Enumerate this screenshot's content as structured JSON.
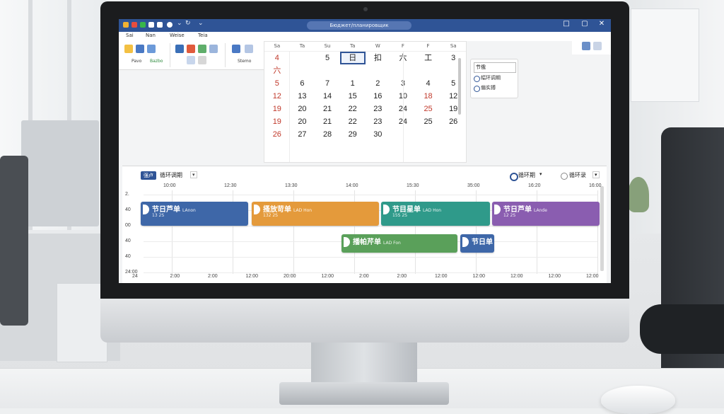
{
  "window": {
    "title": "Бюджет/планировщик",
    "controls": [
      "□",
      "▢",
      "✕"
    ]
  },
  "menu": [
    "Sai",
    "Nan",
    "Weise",
    "Teia"
  ],
  "ribbon": {
    "groups": [
      {
        "label": "Pavo"
      },
      {
        "label": "Bazbo"
      },
      {
        "label": "Stemo"
      }
    ]
  },
  "calendar": {
    "headers": [
      "Sa",
      "Ta",
      "Su",
      "Ta",
      "W",
      "F",
      "F",
      "Sa"
    ],
    "rows": [
      [
        "4",
        "",
        "5",
        "日",
        "扣",
        "六",
        "工",
        "3"
      ],
      [
        "六",
        "",
        "",
        "",
        "",
        "",
        "",
        ""
      ],
      [
        "5",
        "6",
        "7",
        "1",
        "2",
        "3",
        "4",
        "5"
      ],
      [
        "12",
        "13",
        "14",
        "15",
        "16",
        "10",
        "18",
        "12"
      ],
      [
        "19",
        "20",
        "21",
        "22",
        "23",
        "24",
        "25",
        "19"
      ],
      [
        "19",
        "20",
        "21",
        "22",
        "23",
        "24",
        "25",
        "26"
      ],
      [
        "26",
        "27",
        "28",
        "29",
        "30",
        "",
        "",
        ""
      ]
    ]
  },
  "options": {
    "input_value": "节俄",
    "radio1": "幅环调期",
    "radio2": "偏实搏"
  },
  "schedule": {
    "tag": "强卢",
    "label": "循环调期",
    "right_radio1": "循环期",
    "right_radio2": "循环录",
    "top_ticks": [
      "10:00",
      "12:30",
      "13:30",
      "14:00",
      "15:30",
      "35:00",
      "16:20",
      "16:00"
    ],
    "left_ticks": [
      "2.",
      "40",
      "00",
      "40",
      "40",
      "24:00"
    ],
    "bottom_ticks": [
      "24",
      "2:00",
      "2:00",
      "12:00",
      "20:00",
      "12:00",
      "2:00",
      "2:00",
      "12:00",
      "12:00",
      "12:00",
      "12:00",
      "12:00"
    ],
    "events": [
      {
        "title": "节日芦单",
        "note": "LAnon",
        "time": "13 2S",
        "color": "#3e67a8"
      },
      {
        "title": "搔放苛单",
        "note": "LAD Hon",
        "time": "132 2S",
        "color": "#e49a3b"
      },
      {
        "title": "节目星单",
        "note": "LAD Hon",
        "time": "15S 2S",
        "color": "#2f9a8a"
      },
      {
        "title": "节日芦单",
        "note": "LAnde",
        "time": "12 2S",
        "color": "#8a5db0"
      },
      {
        "title": "播帕芹单",
        "note": "LAD Fon",
        "time": "",
        "color": "#5aa05a"
      },
      {
        "title": "节日单",
        "note": "",
        "time": "",
        "color": "#3e67a8"
      }
    ]
  }
}
